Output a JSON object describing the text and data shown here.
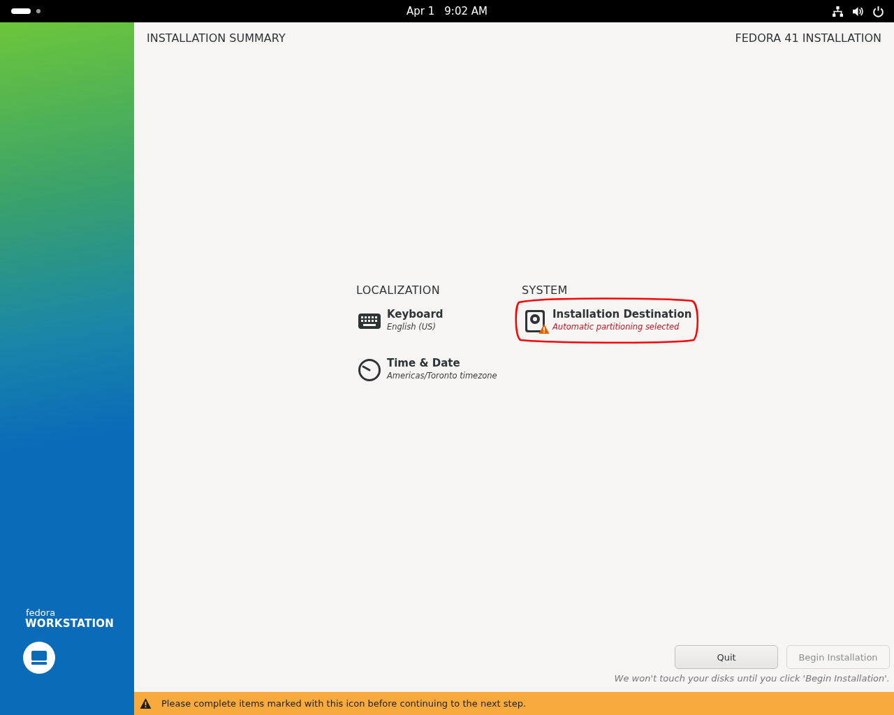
{
  "top_bar": {
    "date": "Apr 1",
    "time": "9:02 AM"
  },
  "sidebar": {
    "logo_small": "fedora",
    "logo_large": "WORKSTATION"
  },
  "header": {
    "title": "INSTALLATION SUMMARY",
    "product": "FEDORA 41 INSTALLATION"
  },
  "categories": [
    {
      "title": "LOCALIZATION",
      "spokes": [
        {
          "kind": "keyboard",
          "title": "Keyboard",
          "status": "English (US)",
          "warning": false,
          "highlighted": false
        },
        {
          "kind": "clock",
          "title": "Time & Date",
          "status": "Americas/Toronto timezone",
          "warning": false,
          "highlighted": false
        }
      ]
    },
    {
      "title": "SYSTEM",
      "spokes": [
        {
          "kind": "disk",
          "title": "Installation Destination",
          "status": "Automatic partitioning selected",
          "warning": true,
          "highlighted": true
        }
      ]
    }
  ],
  "buttons": [
    {
      "label": "Quit",
      "disabled": false
    },
    {
      "label": "Begin Installation",
      "disabled": true
    }
  ],
  "note": "We won't touch your disks until you click 'Begin Installation'.",
  "warning_bar": "Please complete items marked with this icon before continuing to the next step."
}
